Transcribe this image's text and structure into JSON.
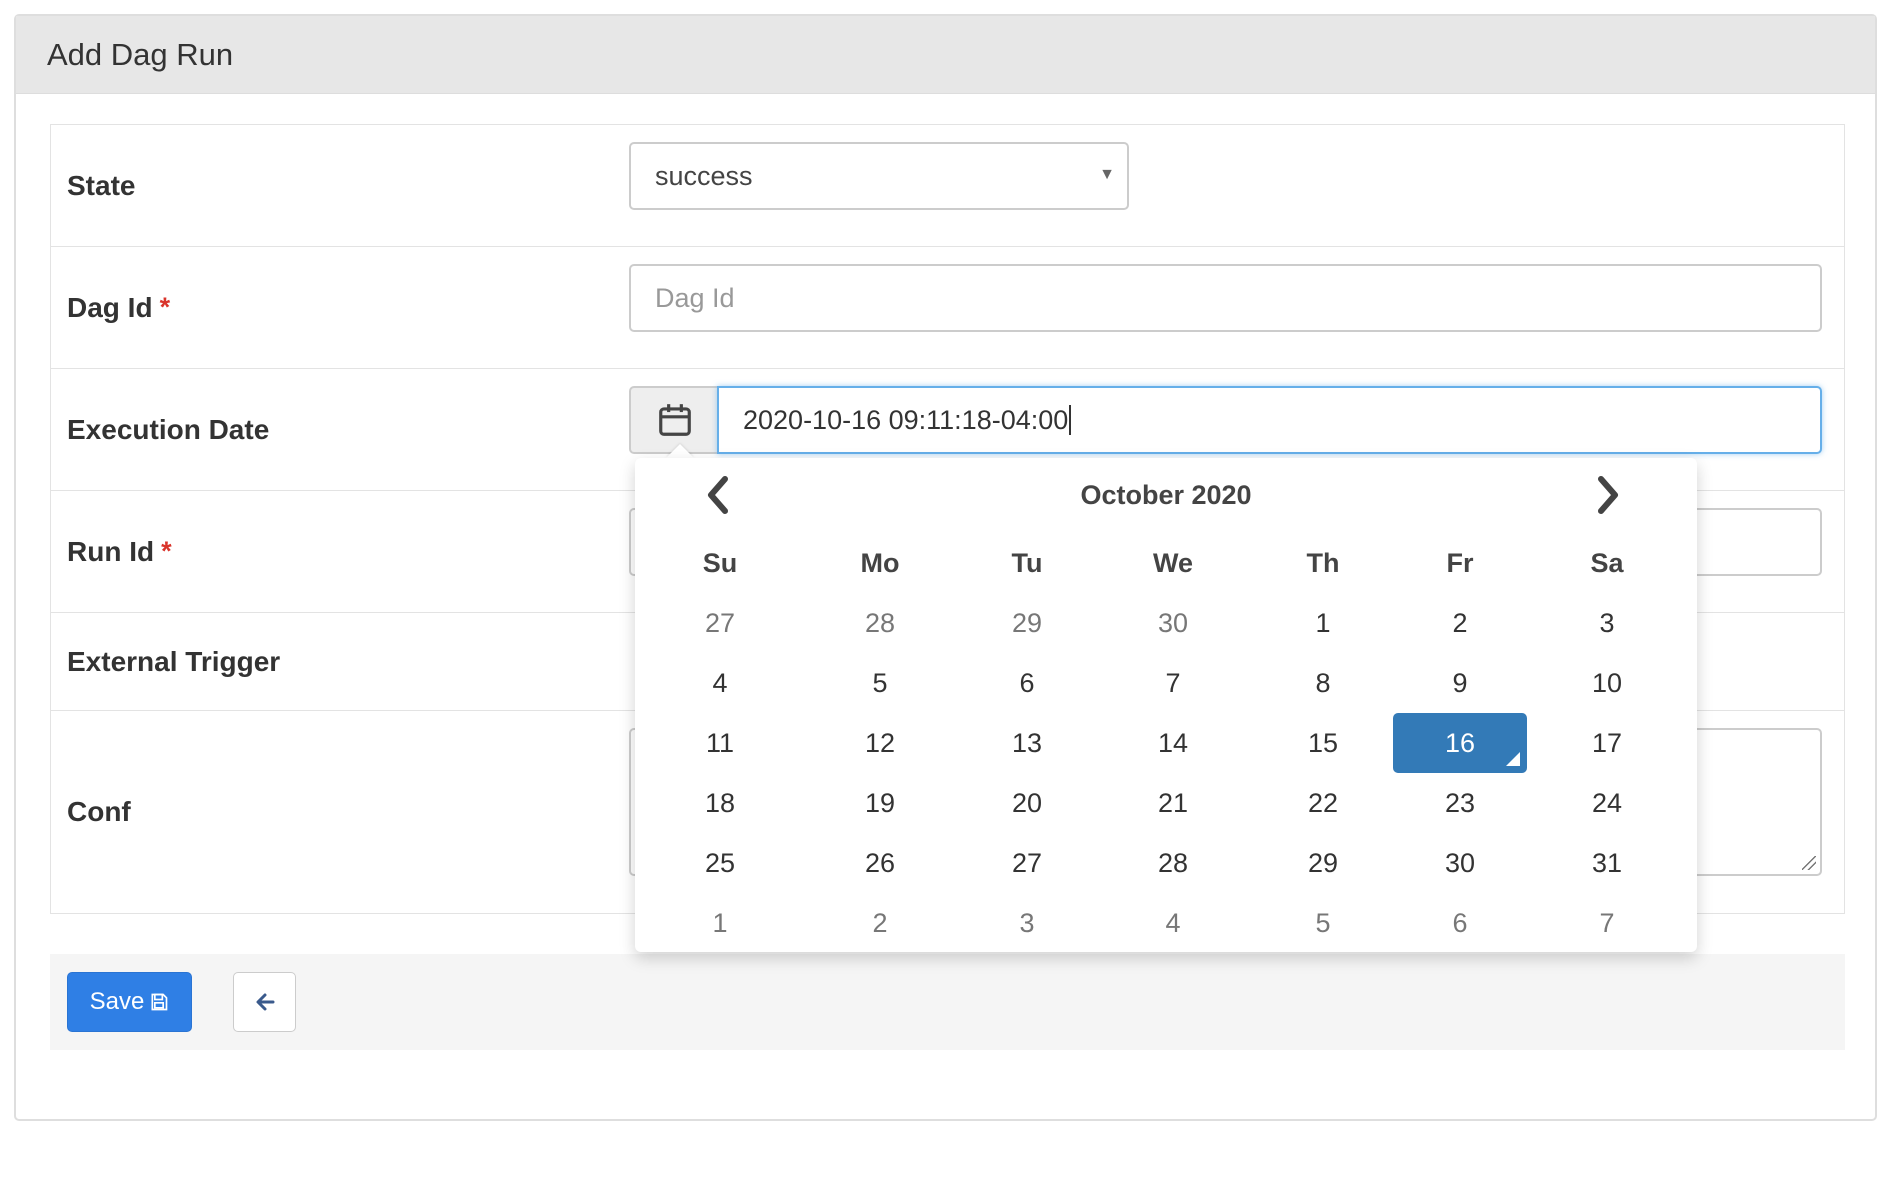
{
  "panel": {
    "title": "Add Dag Run"
  },
  "form": {
    "state": {
      "label": "State",
      "value": "success"
    },
    "dag_id": {
      "label": "Dag Id",
      "required_mark": "*",
      "value": "",
      "placeholder": "Dag Id"
    },
    "execution_date": {
      "label": "Execution Date",
      "value": "2020-10-16 09:11:18-04:00"
    },
    "run_id": {
      "label": "Run Id",
      "required_mark": "*",
      "value": ""
    },
    "external_trigger": {
      "label": "External Trigger",
      "checked": false
    },
    "conf": {
      "label": "Conf",
      "value": ""
    }
  },
  "footer": {
    "save_label": "Save",
    "save_icon": "floppy-disk-icon",
    "back_icon": "arrow-left-icon"
  },
  "datepicker": {
    "month_label": "October 2020",
    "days_of_week": [
      "Su",
      "Mo",
      "Tu",
      "We",
      "Th",
      "Fr",
      "Sa"
    ],
    "weeks": [
      [
        "27",
        "28",
        "29",
        "30",
        "1",
        "2",
        "3"
      ],
      [
        "4",
        "5",
        "6",
        "7",
        "8",
        "9",
        "10"
      ],
      [
        "11",
        "12",
        "13",
        "14",
        "15",
        "16",
        "17"
      ],
      [
        "18",
        "19",
        "20",
        "21",
        "22",
        "23",
        "24"
      ],
      [
        "25",
        "26",
        "27",
        "28",
        "29",
        "30",
        "31"
      ],
      [
        "1",
        "2",
        "3",
        "4",
        "5",
        "6",
        "7"
      ]
    ],
    "selected_day": "16",
    "prev_icon": "chevron-left-icon",
    "next_icon": "chevron-right-icon",
    "colors": {
      "selected_bg": "#337ab7",
      "primary_button": "#2f7fe5",
      "focus_border": "#66afe9",
      "required": "#d9342b"
    }
  }
}
